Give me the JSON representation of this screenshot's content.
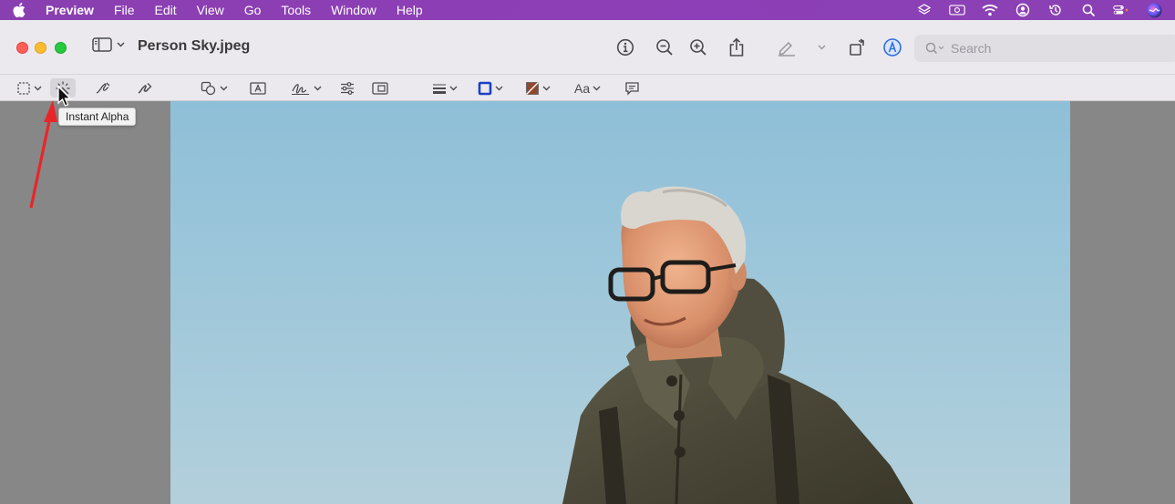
{
  "menubar": {
    "app_name": "Preview",
    "items": [
      "File",
      "Edit",
      "View",
      "Go",
      "Tools",
      "Window",
      "Help"
    ],
    "status_icons": [
      "layers-icon",
      "screen-record-icon",
      "wifi-icon",
      "user-icon",
      "time-machine-icon",
      "spotlight-icon",
      "control-center-icon",
      "siri-icon"
    ]
  },
  "window": {
    "title": "Person Sky.jpeg",
    "search": {
      "placeholder": "Search",
      "value": ""
    }
  },
  "toolbar": {
    "icons": [
      "info-icon",
      "zoom-out-icon",
      "zoom-in-icon",
      "share-icon",
      "highlight-icon",
      "rotate-icon",
      "markup-icon"
    ]
  },
  "markup": {
    "tools": [
      "selection-tool-icon",
      "instant-alpha-icon",
      "sketch-icon",
      "draw-icon",
      "shapes-icon",
      "text-icon",
      "sign-icon",
      "adjust-color-icon",
      "adjust-size-icon",
      "shape-style-icon",
      "border-color-icon",
      "fill-color-icon",
      "text-style-icon",
      "annotate-icon"
    ],
    "text_style_label": "Aa",
    "border_color": "#1d3fc7",
    "fill_color": "#8e4a2f"
  },
  "tooltip": {
    "text": "Instant Alpha"
  },
  "colors": {
    "menubar": "#8b3fb3",
    "window_bg": "#ebe9ed",
    "sky": "#9cc6da",
    "annotation_arrow": "#e8262a"
  },
  "photo": {
    "subject": "elderly man with glasses in hooded jacket against blue sky"
  }
}
